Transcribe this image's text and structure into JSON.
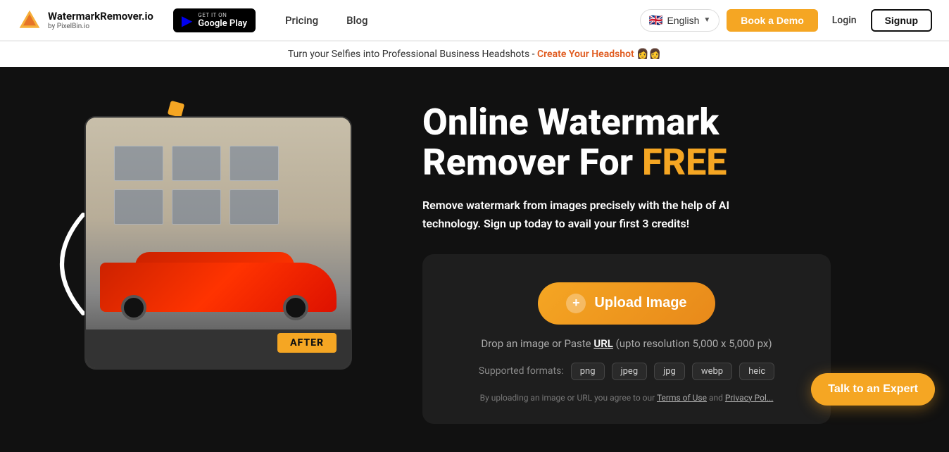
{
  "navbar": {
    "logo_main": "WatermarkRemover.io",
    "logo_sub": "by PixelBin.io",
    "google_play_small": "GET IT ON",
    "google_play_big": "Google Play",
    "nav_pricing": "Pricing",
    "nav_blog": "Blog",
    "lang_label": "English",
    "book_demo": "Book a Demo",
    "login": "Login",
    "signup": "Signup"
  },
  "announcement": {
    "text": "Turn your Selfies into Professional Business Headshots -",
    "link_text": "Create Your Headshot",
    "emoji": "👩👩"
  },
  "hero": {
    "title_line1": "Online Watermark",
    "title_line2": "Remover For ",
    "title_free": "FREE",
    "description": "Remove watermark from images precisely with the help of AI technology. Sign up today to avail your first 3 credits!",
    "after_badge": "AFTER"
  },
  "upload": {
    "button_label": "Upload Image",
    "drop_text_before": "Drop an image or Paste",
    "url_label": "URL",
    "drop_text_after": "(upto resolution 5,000 x 5,000 px)",
    "formats_label": "Supported formats:",
    "formats": [
      "png",
      "jpeg",
      "jpg",
      "webp",
      "heic"
    ],
    "tos_text": "By uploading an image or URL you agree to our",
    "tos_link": "Terms of Use",
    "and": "and",
    "privacy_link": "Privacy Pol..."
  },
  "talk_expert": {
    "label": "Talk to an Expert"
  },
  "colors": {
    "accent": "#f5a623",
    "bg_dark": "#111111",
    "bg_card": "#1e1e1e",
    "text_light": "#ffffff",
    "text_muted": "#aaaaaa"
  }
}
